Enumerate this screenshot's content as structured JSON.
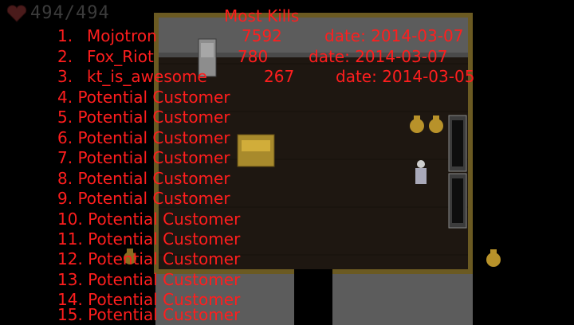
{
  "hud": {
    "health_text": "494/494"
  },
  "leaderboard": {
    "title": "Most Kills",
    "top_entries": [
      {
        "rank": "1.",
        "name": "Mojotron",
        "score": "7592",
        "date": "date: 2014-03-07"
      },
      {
        "rank": "2.",
        "name": "Fox_Riot",
        "score": "780",
        "date": "date: 2014-03-07"
      },
      {
        "rank": "3.",
        "name": "kt_is_awesome",
        "score": "267",
        "date": "date: 2014-03-05"
      }
    ],
    "placeholder_entries": [
      "4. Potential Customer",
      "5. Potential Customer",
      "6. Potential Customer",
      "7. Potential Customer",
      "8. Potential Customer",
      "9. Potential Customer",
      "10. Potential Customer",
      "11. Potential Customer",
      "12. Potential Customer",
      "13. Potential Customer",
      "14. Potential Customer",
      "15. Potential Customer"
    ]
  },
  "colors": {
    "leaderboard_text": "#ff1e1e",
    "floor": "#1e1711",
    "wall_trim": "#6b5a22",
    "hud_text": "#3b3b3b"
  }
}
